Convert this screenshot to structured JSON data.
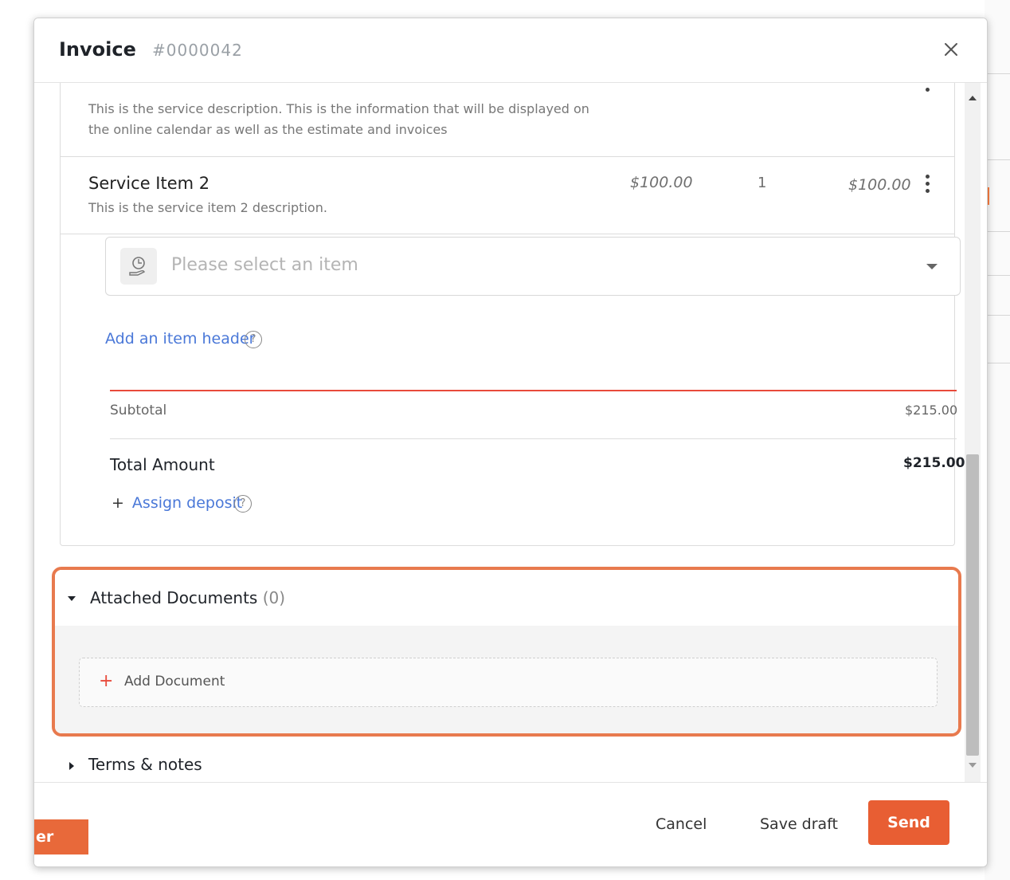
{
  "header": {
    "title": "Invoice",
    "number": "#0000042"
  },
  "items": [
    {
      "description": "This is the service description. This is the information that will be displayed on the online calendar as well as the estimate and invoices"
    },
    {
      "name": "Service Item 2",
      "description": "This is the service item 2 description.",
      "price": "$100.00",
      "qty": "1",
      "total": "$100.00"
    }
  ],
  "item_select": {
    "placeholder": "Please select an item"
  },
  "add_item_header": "Add an item header",
  "subtotal": {
    "label": "Subtotal",
    "value": "$215.00"
  },
  "total": {
    "label": "Total Amount",
    "value": "$215.00"
  },
  "assign_deposit": {
    "plus": "+",
    "label": "Assign deposit"
  },
  "attached_documents": {
    "title": "Attached Documents",
    "count": "(0)",
    "add_label": "Add Document",
    "add_plus": "+"
  },
  "terms": {
    "label": "Terms & notes"
  },
  "footer": {
    "cancel": "Cancel",
    "save_draft": "Save draft",
    "send": "Send",
    "partial_button": "er"
  },
  "help_glyph": "?",
  "colors": {
    "accent": "#e85e33",
    "link": "#4a78d8",
    "highlight_border": "#e87a4e",
    "divider_red": "#e84a3b"
  },
  "icons": [
    "close-icon",
    "help-icon",
    "item-select-icon",
    "caret-down-icon",
    "kebab-menu-icon",
    "plus-icon",
    "triangle-down-icon",
    "triangle-right-icon"
  ]
}
